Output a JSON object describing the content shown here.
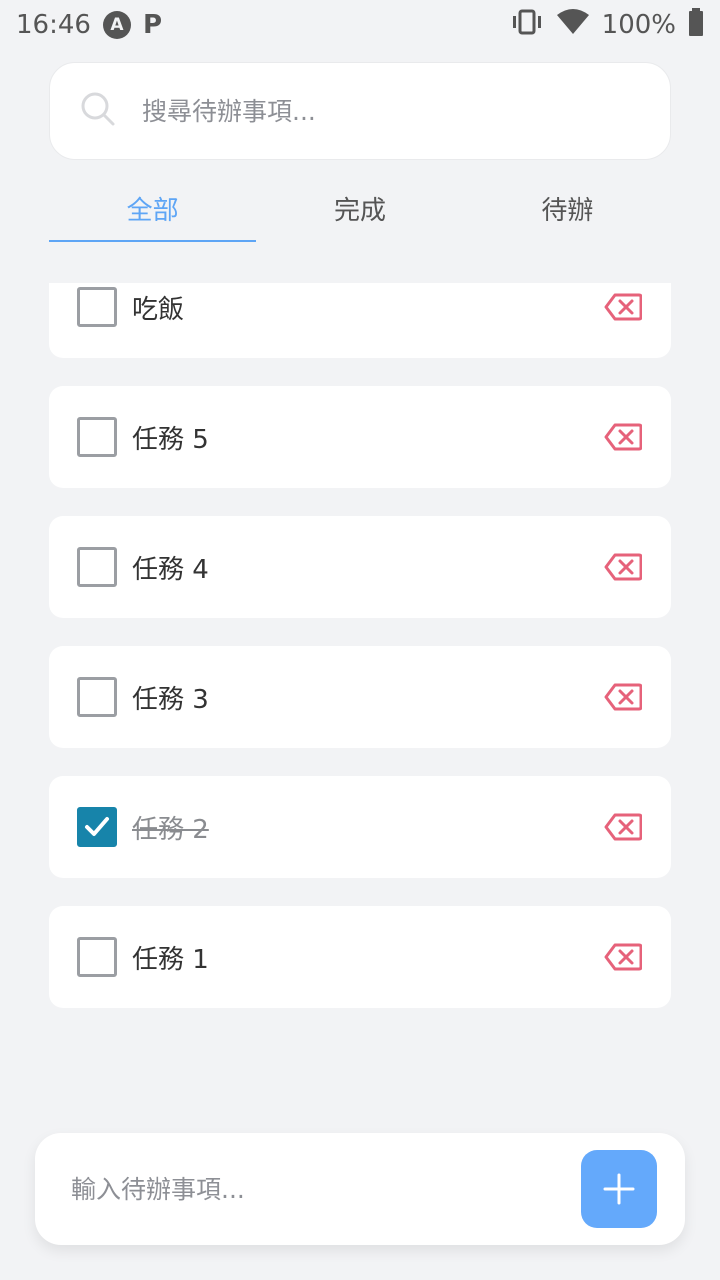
{
  "status_bar": {
    "time": "16:46",
    "badge_a": "A",
    "badge_p": "P",
    "battery": "100%"
  },
  "search": {
    "placeholder": "搜尋待辦事項..."
  },
  "tabs": [
    {
      "label": "全部"
    },
    {
      "label": "完成"
    },
    {
      "label": "待辦"
    }
  ],
  "todos": [
    {
      "label": "吃飯",
      "checked": false
    },
    {
      "label": "任務 5",
      "checked": false
    },
    {
      "label": "任務 4",
      "checked": false
    },
    {
      "label": "任務 3",
      "checked": false
    },
    {
      "label": "任務 2",
      "checked": true
    },
    {
      "label": "任務 1",
      "checked": false
    }
  ],
  "add_bar": {
    "placeholder": "輸入待辦事項..."
  },
  "colors": {
    "accent": "#5ea5f5",
    "checked": "#1784aa",
    "delete": "#e6627a",
    "add_button": "#64a9fb",
    "background": "#f2f3f5"
  }
}
